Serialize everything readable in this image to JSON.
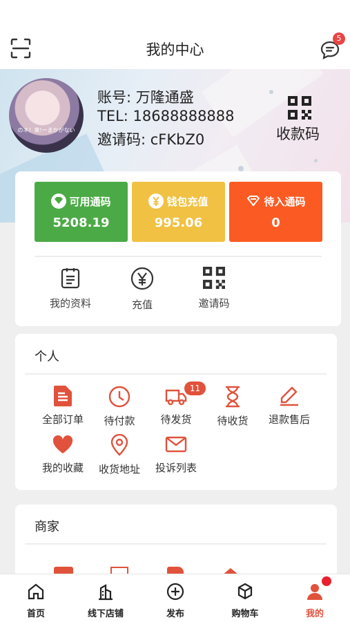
{
  "header": {
    "title": "我的中心",
    "message_badge": "5"
  },
  "profile": {
    "account": "账号: 万隆通盛",
    "tel": "TEL: 18688888888",
    "invite": "邀请码: cFKbZ0",
    "avatar_caption": "のネ！来!ーまかがない",
    "qr_label": "收款码"
  },
  "wallet": [
    {
      "title": "可用通码",
      "value": "5208.19",
      "color": "#4caa46"
    },
    {
      "title": "钱包充值",
      "value": "995.06",
      "color": "#f1c143"
    },
    {
      "title": "待入通码",
      "value": "0",
      "color": "#fb5b22"
    }
  ],
  "quick": [
    {
      "label": "我的资料",
      "icon": "clipboard-icon"
    },
    {
      "label": "充值",
      "icon": "yen-circle-icon"
    },
    {
      "label": "邀请码",
      "icon": "qr-code-icon"
    }
  ],
  "personal": {
    "title": "个人",
    "items": [
      {
        "label": "全部订单",
        "icon": "document-icon"
      },
      {
        "label": "待付款",
        "icon": "clock-icon"
      },
      {
        "label": "待发货",
        "icon": "truck-icon",
        "badge": "11"
      },
      {
        "label": "待收货",
        "icon": "hourglass-icon"
      },
      {
        "label": "退款售后",
        "icon": "pencil-icon"
      },
      {
        "label": "我的收藏",
        "icon": "heart-icon"
      },
      {
        "label": "收货地址",
        "icon": "location-pin-icon"
      },
      {
        "label": "投诉列表",
        "icon": "envelope-icon"
      }
    ]
  },
  "merchant": {
    "title": "商家"
  },
  "tabbar": [
    {
      "label": "首页",
      "icon": "home-icon"
    },
    {
      "label": "线下店铺",
      "icon": "building-icon"
    },
    {
      "label": "发布",
      "icon": "plus-circle-icon"
    },
    {
      "label": "购物车",
      "icon": "cube-icon"
    },
    {
      "label": "我的",
      "icon": "user-icon",
      "active": true
    }
  ],
  "colors": {
    "accent": "#e0523c",
    "green": "#4caa46",
    "yellow": "#f1c143",
    "orange": "#fb5b22"
  }
}
